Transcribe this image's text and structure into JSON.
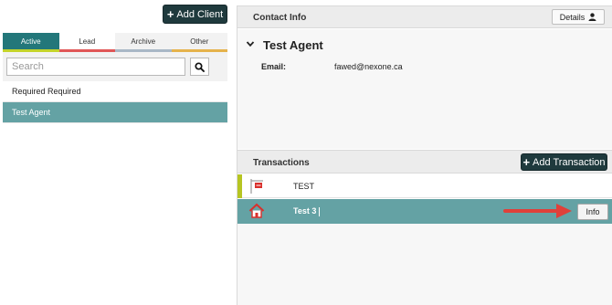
{
  "left": {
    "add_client_label": "Add Client",
    "tabs": [
      {
        "label": "Active",
        "color": "#c4d42a"
      },
      {
        "label": "Lead",
        "color": "#e05656"
      },
      {
        "label": "Archive",
        "color": "#a9b7c6"
      },
      {
        "label": "Other",
        "color": "#e5b24b"
      }
    ],
    "search": {
      "placeholder": "Search",
      "value": ""
    },
    "clients": [
      {
        "label": "Required Required",
        "selected": false
      },
      {
        "label": "Test Agent",
        "selected": true
      }
    ]
  },
  "contact": {
    "section_title": "Contact Info",
    "details_label": "Details",
    "agent_name": "Test Agent",
    "email_label": "Email:",
    "email_value": "fawed@nexone.ca"
  },
  "transactions": {
    "section_title": "Transactions",
    "add_label": "Add Transaction",
    "rows": [
      {
        "label": "TEST",
        "icon": "sign-icon"
      },
      {
        "label": "Test 3",
        "icon": "home-icon",
        "selected": true,
        "info_label": "Info"
      }
    ]
  },
  "colors": {
    "teal": "#23777a",
    "selected_teal": "#64a2a4",
    "dark_button": "#1f3a3d",
    "arrow_red": "#e0403a"
  }
}
